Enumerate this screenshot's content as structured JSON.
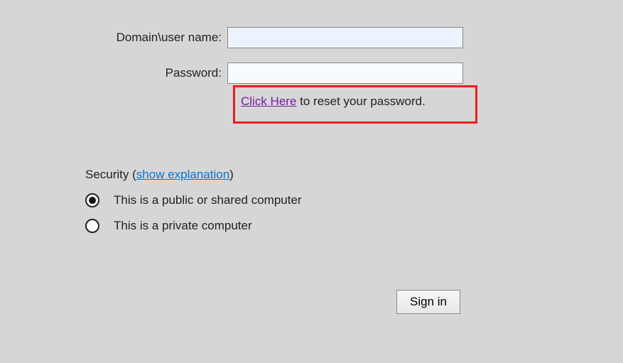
{
  "fields": {
    "username_label": "Domain\\user name:",
    "username_value": "",
    "password_label": "Password:",
    "password_value": ""
  },
  "reset": {
    "link_text": "Click Here",
    "suffix_text": " to reset your password."
  },
  "security": {
    "heading_prefix": "Security (",
    "show_link": "show explanation",
    "heading_suffix": ")",
    "options": {
      "public": "This is a public or shared computer",
      "private": "This is a private computer"
    }
  },
  "signin_label": "Sign in"
}
